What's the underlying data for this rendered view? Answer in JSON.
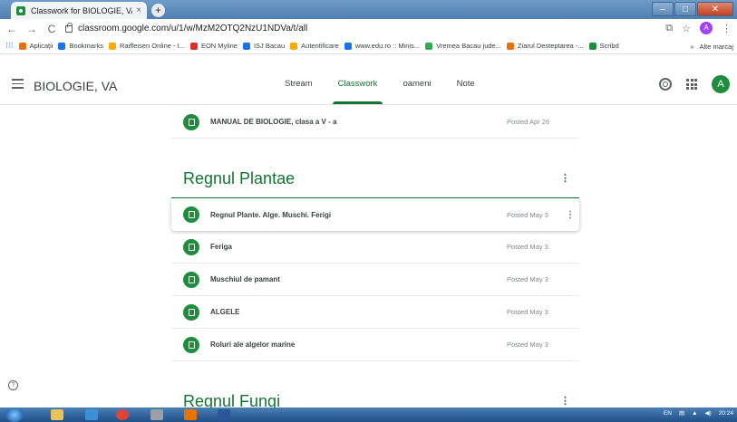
{
  "browser": {
    "tab_title": "Classwork for BIOLOGIE, VA",
    "tab_close": "×",
    "new_tab": "+",
    "url": "classroom.google.com/u/1/w/MzM2OTQ2NzU1NDVa/t/all",
    "profile_letter": "A",
    "window_controls": {
      "minimize": "–",
      "maximize": "□",
      "close": "✕"
    }
  },
  "bookmarks": {
    "items": [
      {
        "label": "Aplicații",
        "color": "#e8710a"
      },
      {
        "label": "Bookmarks",
        "color": "#1a73e8"
      },
      {
        "label": "Raiffeisen Online - I...",
        "color": "#f9ab00"
      },
      {
        "label": "EON Myline",
        "color": "#d93025"
      },
      {
        "label": "ISJ Bacau",
        "color": "#1a73e8"
      },
      {
        "label": "Autentificare",
        "color": "#f9ab00"
      },
      {
        "label": "www.edu.ro :: Minis...",
        "color": "#1a73e8"
      },
      {
        "label": "Vremea Bacau jude...",
        "color": "#34a853"
      },
      {
        "label": "Ziarul Desteptarea -...",
        "color": "#e8710a"
      },
      {
        "label": "Scribd",
        "color": "#1e8e3e"
      }
    ],
    "overflow": "»",
    "other": "Alte marcaj"
  },
  "header": {
    "class_name": "BIOLOGIE, VA",
    "tabs": [
      {
        "label": "Stream"
      },
      {
        "label": "Classwork",
        "active": true
      },
      {
        "label": "oameni"
      },
      {
        "label": "Note"
      }
    ],
    "avatar_letter": "A"
  },
  "classwork": {
    "top_item": {
      "title": "MANUAL DE BIOLOGIE, clasa a V - a",
      "posted": "Posted Apr 26"
    },
    "topics": [
      {
        "name": "Regnul Plantae",
        "items": [
          {
            "title": "Regnul Plante. Alge. Muschi. Ferigi",
            "posted": "Posted May 3"
          },
          {
            "title": "Feriga",
            "posted": "Posted May 3"
          },
          {
            "title": "Muschiul de pamant",
            "posted": "Posted May 3"
          },
          {
            "title": "ALGELE",
            "posted": "Posted May 3"
          },
          {
            "title": "Roluri ale algelor marine",
            "posted": "Posted May 3"
          }
        ]
      },
      {
        "name": "Regnul Fungi",
        "items": []
      }
    ],
    "more_symbol": "⋮",
    "help_symbol": "?"
  },
  "taskbar": {
    "lang": "EN",
    "time": "20:24"
  },
  "colors": {
    "accent_green": "#137333",
    "assignment_green": "#1e8e3e"
  }
}
